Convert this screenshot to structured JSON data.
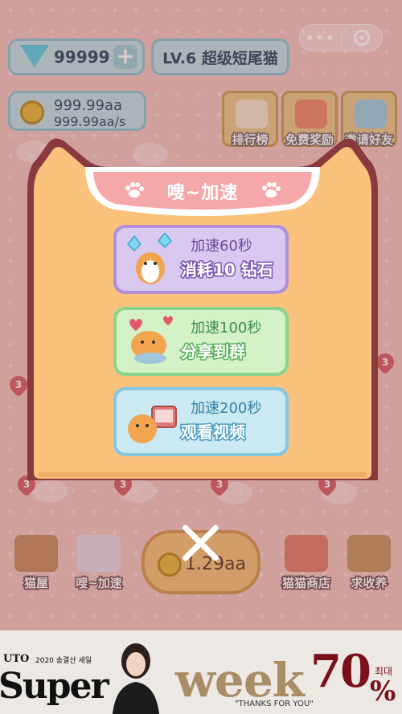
{
  "top_bar": {
    "capsule_icons": [
      "more-icon",
      "target-icon"
    ],
    "more_label": "•••"
  },
  "resources": {
    "diamonds": "99999",
    "plus_label": "+",
    "level": "LV.6 超级短尾猫",
    "coins": "999.99aa",
    "coin_rate": "999.99aa/s"
  },
  "side_buttons": [
    {
      "label": "排行榜",
      "icon": "ranking-icon"
    },
    {
      "label": "免费奖励",
      "icon": "gift-icon"
    },
    {
      "label": "邀请好友",
      "icon": "fish-icon"
    }
  ],
  "slot_badges": [
    "3",
    "3",
    "3",
    "3",
    "3",
    "3"
  ],
  "modal": {
    "title": "嗖~加速",
    "options": [
      {
        "line1": "加速60秒",
        "line2": "消耗10 钻石",
        "icon": "diamond-cat-icon"
      },
      {
        "line1": "加速100秒",
        "line2": "分享到群",
        "icon": "share-cat-icon"
      },
      {
        "line1": "加速200秒",
        "line2": "观看视频",
        "icon": "tv-cat-icon"
      }
    ]
  },
  "bottom_bar": {
    "left_buttons": [
      {
        "label": "猫屋",
        "icon": "cat-house-icon"
      },
      {
        "label": "嗖~加速",
        "icon": "speed-cat-icon"
      }
    ],
    "coin_total": "1.29aa",
    "right_buttons": [
      {
        "label": "猫猫商店",
        "icon": "shop-icon"
      },
      {
        "label": "求收养",
        "icon": "box-icon"
      }
    ]
  },
  "ad": {
    "brand": "UTO",
    "subtitle": "2020 송결산 세일",
    "headline_left": "Super",
    "headline_right": "week",
    "tagline": "\"THANKS FOR YOU\"",
    "discount": "70",
    "discount_prefix": "최대",
    "discount_unit": "%"
  },
  "colors": {
    "modal_fill": "#fbc27e",
    "modal_border": "#8a3a3e",
    "title_ribbon": "#f5a7aa",
    "purple_option": "#b08fd8",
    "green_option": "#8ed38c",
    "blue_option": "#86c8e0"
  }
}
